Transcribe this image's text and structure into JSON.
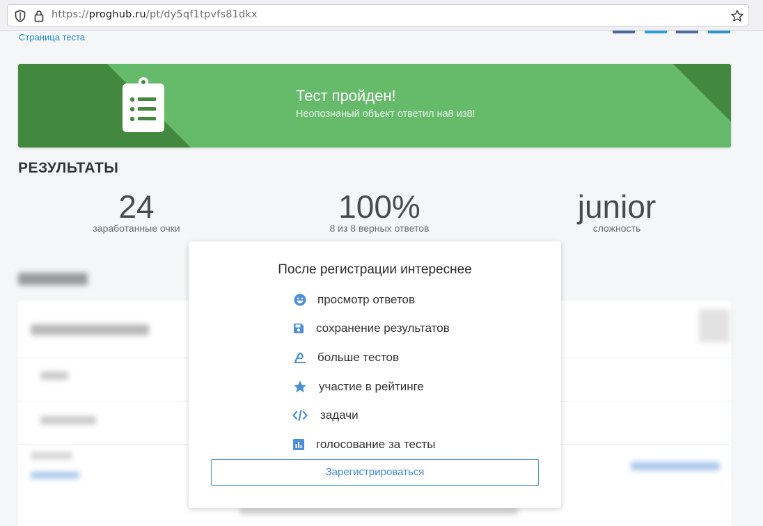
{
  "browser": {
    "url_scheme": "https://",
    "url_host": "proghub.ru",
    "url_path": "/pt/dy5qf1tpvfs81dkx"
  },
  "page": {
    "breadcrumb_link": "Страница теста"
  },
  "banner": {
    "title": "Тест пройден!",
    "subtitle": "Неопознаный объект ответил на8 из8!"
  },
  "results": {
    "heading": "РЕЗУЛЬТАТЫ",
    "stats": [
      {
        "value": "24",
        "label": "заработанные очки"
      },
      {
        "value": "100%",
        "label": "8 из 8 верных ответов"
      },
      {
        "value": "junior",
        "label": "сложность"
      }
    ]
  },
  "modal": {
    "title": "После регистрации интереснее",
    "features": [
      {
        "icon": "smile-icon",
        "label": "просмотр ответов"
      },
      {
        "icon": "floppy-disk-icon",
        "label": "сохранение результатов"
      },
      {
        "icon": "tests-icon",
        "label": "больше тестов"
      },
      {
        "icon": "star-icon",
        "label": "участие в рейтинге"
      },
      {
        "icon": "code-icon",
        "label": "задачи"
      },
      {
        "icon": "bar-chart-icon",
        "label": "голосование за тесты"
      }
    ],
    "register_button": "Зарегистрироваться"
  },
  "colors": {
    "banner_green": "#66bb6a",
    "banner_dark_green": "#43883f",
    "accent_blue": "#3b86d6",
    "icon_blue": "#4a8fd8"
  }
}
